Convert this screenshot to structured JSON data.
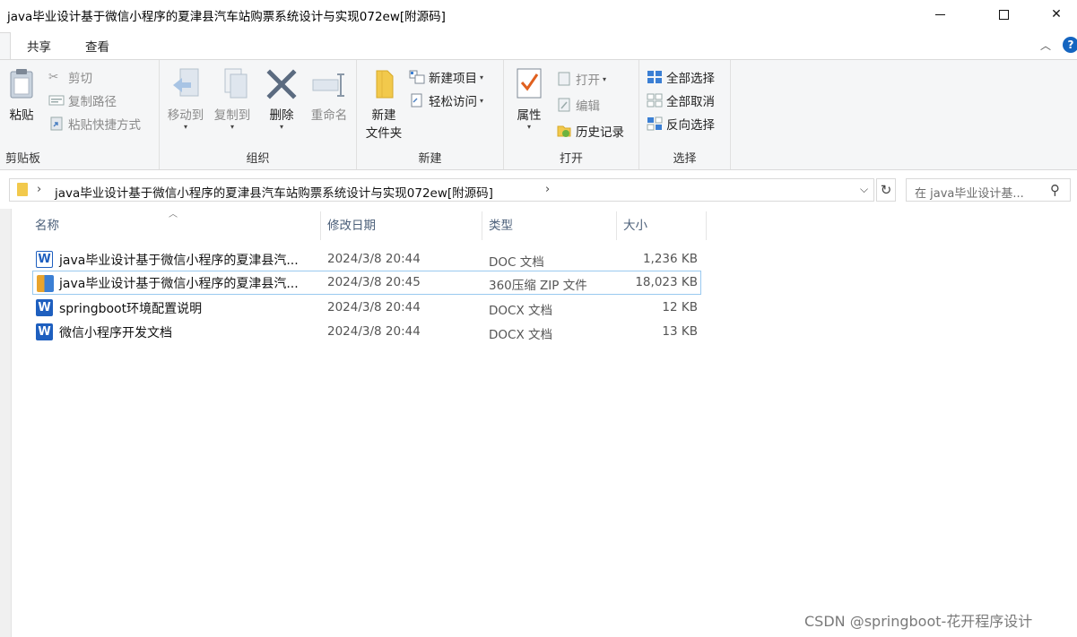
{
  "window": {
    "title": "java毕业设计基于微信小程序的夏津县汽车站购票系统设计与实现072ew[附源码]",
    "minimize_glyph": "",
    "close_glyph": "✕"
  },
  "tabs": [
    {
      "label": "共享"
    },
    {
      "label": "查看"
    }
  ],
  "ribbon": {
    "clipboard": {
      "label": "剪贴板",
      "paste": "粘贴",
      "cut": "剪切",
      "copy_path": "复制路径",
      "paste_shortcut": "粘贴快捷方式"
    },
    "organize": {
      "label": "组织",
      "move_to": "移动到",
      "copy_to": "复制到",
      "delete": "删除",
      "rename": "重命名"
    },
    "new": {
      "label": "新建",
      "new_folder_line1": "新建",
      "new_folder_line2": "文件夹",
      "new_item": "新建项目",
      "easy_access": "轻松访问"
    },
    "open": {
      "label": "打开",
      "properties": "属性",
      "open": "打开",
      "edit": "编辑",
      "history": "历史记录"
    },
    "select": {
      "label": "选择",
      "select_all": "全部选择",
      "select_none": "全部取消",
      "invert": "反向选择"
    }
  },
  "address": {
    "path": "java毕业设计基于微信小程序的夏津县汽车站购票系统设计与实现072ew[附源码]",
    "search_placeholder": "在 java毕业设计基..."
  },
  "columns": {
    "name": "名称",
    "modified": "修改日期",
    "type": "类型",
    "size": "大小"
  },
  "files": [
    {
      "name": "java毕业设计基于微信小程序的夏津县汽...",
      "modified": "2024/3/8 20:44",
      "type": "DOC 文档",
      "size": "1,236 KB",
      "icon": "word-doc-icon"
    },
    {
      "name": "java毕业设计基于微信小程序的夏津县汽...",
      "modified": "2024/3/8 20:45",
      "type": "360压缩 ZIP 文件",
      "size": "18,023 KB",
      "icon": "zip-archive-icon"
    },
    {
      "name": "springboot环境配置说明",
      "modified": "2024/3/8 20:44",
      "type": "DOCX 文档",
      "size": "12 KB",
      "icon": "word-docx-icon"
    },
    {
      "name": "微信小程序开发文档",
      "modified": "2024/3/8 20:44",
      "type": "DOCX 文档",
      "size": "13 KB",
      "icon": "word-docx-icon"
    }
  ],
  "watermark": "CSDN @springboot-花开程序设计"
}
